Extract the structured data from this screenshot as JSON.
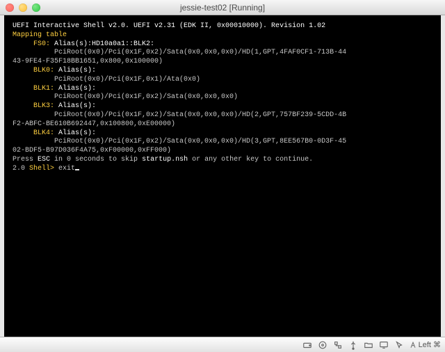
{
  "window": {
    "title": "jessie-test02 [Running]"
  },
  "term": {
    "header": "UEFI Interactive Shell v2.0. UEFI v2.31 (EDK II, 0x00010000). Revision 1.02",
    "mapping_label": "Mapping table",
    "fs0_label": "FS0:",
    "fs0_alias": " Alias(s):HD10a0a1::BLK2:",
    "fs0_path1": "          PciRoot(0x0)/Pci(0x1F,0x2)/Sata(0x0,0x0,0x0)/HD(1,GPT,4FAF0CF1-713B-44",
    "fs0_path2": "43-9FE4-F35F18BB1651,0x800,0x100000)",
    "blk0_label": "     BLK0:",
    "blk_alias": " Alias(s):",
    "blk0_path": "          PciRoot(0x0)/Pci(0x1F,0x1)/Ata(0x0)",
    "blk1_label": "     BLK1:",
    "blk1_path": "          PciRoot(0x0)/Pci(0x1F,0x2)/Sata(0x0,0x0,0x0)",
    "blk3_label": "     BLK3:",
    "blk3_path1": "          PciRoot(0x0)/Pci(0x1F,0x2)/Sata(0x0,0x0,0x0)/HD(2,GPT,757BF239-5CDD-4B",
    "blk3_path2": "F2-ABFC-BE610B692447,0x100800,0xE00000)",
    "blk4_label": "     BLK4:",
    "blk4_path1": "          PciRoot(0x0)/Pci(0x1F,0x2)/Sata(0x0,0x0,0x0)/HD(3,GPT,8EE567B0-0D3F-45",
    "blk4_path2": "02-BDF5-B97D036F4A75,0xF00000,0xFF000)",
    "press": "Press ",
    "esc": "ESC",
    "skip1": " in 0 seconds to skip ",
    "startup": "startup.nsh",
    "skip2": " or any other key to continue.",
    "prompt_ver": "2.0 ",
    "prompt": "Shell> ",
    "cmd": "exit"
  },
  "statusbar": {
    "hostkey": "Left ⌘"
  }
}
